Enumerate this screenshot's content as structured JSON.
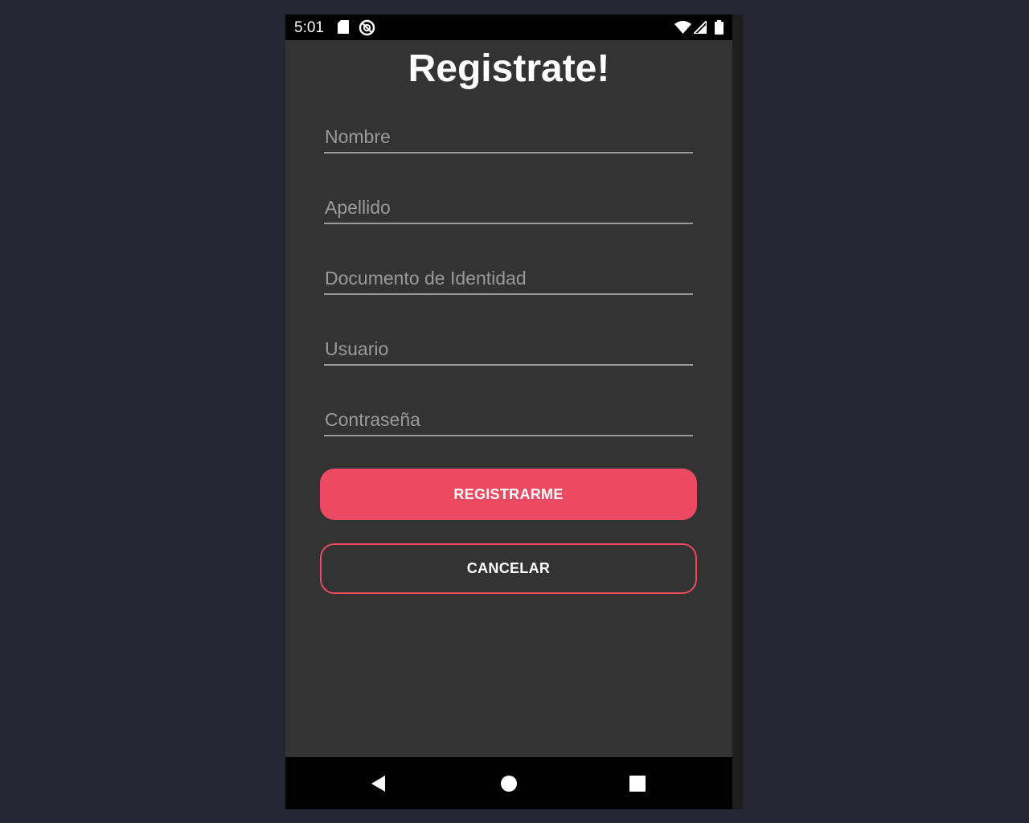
{
  "status_bar": {
    "time": "5:01",
    "left_icons": [
      "sd-card-icon",
      "do-not-disturb-icon"
    ],
    "right_icons": [
      "wifi-icon",
      "signal-icon",
      "battery-icon"
    ]
  },
  "title": "Registrate!",
  "form": {
    "fields": [
      {
        "name": "nombre",
        "placeholder": "Nombre",
        "value": ""
      },
      {
        "name": "apellido",
        "placeholder": "Apellido",
        "value": ""
      },
      {
        "name": "documento",
        "placeholder": "Documento de Identidad",
        "value": ""
      },
      {
        "name": "usuario",
        "placeholder": "Usuario",
        "value": ""
      },
      {
        "name": "contrasena",
        "placeholder": "Contraseña",
        "value": ""
      }
    ],
    "submit_label": "REGISTRARME",
    "cancel_label": "CANCELAR"
  },
  "nav_bar": {
    "buttons": [
      "back-icon",
      "home-icon",
      "recents-icon"
    ]
  },
  "colors": {
    "background": "#242634",
    "screen": "#333333",
    "accent": "#ec4a60",
    "placeholder": "#9a9a9a"
  }
}
